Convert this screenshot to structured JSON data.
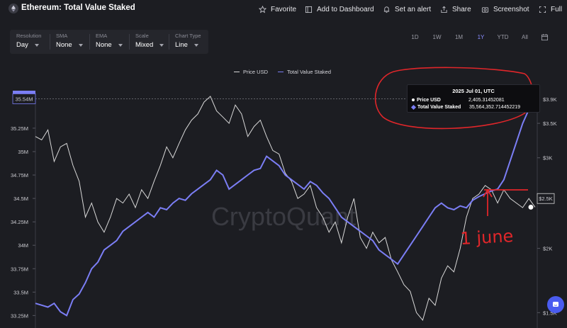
{
  "header": {
    "title": "Ethereum: Total Value Staked",
    "actions": [
      {
        "label": "Favorite",
        "icon": "star-icon"
      },
      {
        "label": "Add to Dashboard",
        "icon": "dashboard-icon"
      },
      {
        "label": "Set an alert",
        "icon": "bell-icon"
      },
      {
        "label": "Share",
        "icon": "share-icon"
      },
      {
        "label": "Screenshot",
        "icon": "camera-icon"
      },
      {
        "label": "Full",
        "icon": "fullscreen-icon"
      }
    ]
  },
  "controls": [
    {
      "label": "Resolution",
      "value": "Day"
    },
    {
      "label": "SMA",
      "value": "None"
    },
    {
      "label": "EMA",
      "value": "None"
    },
    {
      "label": "Scale",
      "value": "Mixed"
    },
    {
      "label": "Chart Type",
      "value": "Line"
    }
  ],
  "ranges": [
    "1D",
    "1W",
    "1M",
    "1Y",
    "YTD",
    "All"
  ],
  "active_range": "1Y",
  "legend": [
    {
      "name": "Price USD",
      "color": "#d8d8d8"
    },
    {
      "name": "Total Value Staked",
      "color": "#7b7ef5"
    }
  ],
  "tooltip": {
    "date": "2025 Jul 01",
    "tz": "UTC",
    "rows": [
      {
        "name": "Price USD",
        "value": "2,405.31452081",
        "marker": "circle"
      },
      {
        "name": "Total Value Staked",
        "value": "35,564,352.714452219",
        "marker": "diamond"
      }
    ]
  },
  "watermark": "CryptoQuant",
  "annotation": {
    "text": "1 june",
    "color": "#e0262a"
  },
  "chart_data": {
    "type": "line",
    "left_axis": {
      "ticks": [
        "35.25M",
        "35M",
        "34.75M",
        "34.5M",
        "34.25M",
        "34M",
        "33.75M",
        "33.5M",
        "33.25M"
      ],
      "tick_values": [
        35250000,
        35000000,
        34750000,
        34500000,
        34250000,
        34000000,
        33750000,
        33500000,
        33250000
      ],
      "current_label": "35.54M",
      "ylim": [
        33200000,
        35620000
      ]
    },
    "right_axis": {
      "ticks": [
        "$3.9K",
        "$3.5K",
        "$3K",
        "$2K",
        "$1.5K"
      ],
      "current_label": "$2.5K",
      "scale": "log",
      "tick_values": [
        3900,
        3500,
        3000,
        2000,
        1500
      ],
      "ylim": [
        1450,
        4000
      ]
    },
    "series": [
      {
        "name": "Total Value Staked",
        "color": "#7b7ef5",
        "values": [
          33380000,
          33360000,
          33340000,
          33380000,
          33290000,
          33250000,
          33420000,
          33480000,
          33600000,
          33750000,
          33820000,
          33950000,
          34000000,
          34050000,
          34150000,
          34200000,
          34250000,
          34300000,
          34350000,
          34300000,
          34400000,
          34380000,
          34450000,
          34500000,
          34480000,
          34550000,
          34600000,
          34650000,
          34700000,
          34800000,
          34750000,
          34600000,
          34650000,
          34700000,
          34750000,
          34800000,
          34820000,
          34950000,
          34900000,
          34850000,
          34750000,
          34700000,
          34650000,
          34600000,
          34680000,
          34640000,
          34560000,
          34500000,
          34400000,
          34300000,
          34250000,
          34200000,
          34150000,
          34100000,
          34050000,
          33950000,
          33900000,
          33850000,
          33800000,
          33900000,
          34000000,
          34100000,
          34200000,
          34300000,
          34400000,
          34450000,
          34400000,
          34380000,
          34420000,
          34400000,
          34480000,
          34520000,
          34550000,
          34580000,
          34600000,
          34700000,
          34900000,
          35100000,
          35300000,
          35450000,
          35564000
        ]
      },
      {
        "name": "Price USD",
        "color": "#d8d8d8",
        "values": [
          3300,
          3250,
          3400,
          2950,
          3150,
          3200,
          2900,
          2700,
          2300,
          2450,
          2250,
          2150,
          2300,
          2500,
          2450,
          2550,
          2400,
          2600,
          2500,
          2700,
          2900,
          3150,
          3000,
          3200,
          3400,
          3550,
          3650,
          3850,
          3950,
          3700,
          3600,
          3500,
          3800,
          3650,
          3300,
          3450,
          3550,
          3300,
          3100,
          3050,
          2800,
          2700,
          2500,
          2550,
          2650,
          2400,
          2300,
          2150,
          2250,
          2050,
          2300,
          2500,
          2100,
          2000,
          2150,
          2050,
          2100,
          1900,
          1800,
          1700,
          1650,
          1500,
          1450,
          1600,
          1550,
          1750,
          1850,
          1800,
          2000,
          2300,
          2500,
          2550,
          2650,
          2600,
          2450,
          2600,
          2500,
          2450,
          2400,
          2500,
          2405
        ]
      }
    ],
    "grid": false,
    "legend_position": "top-center"
  }
}
